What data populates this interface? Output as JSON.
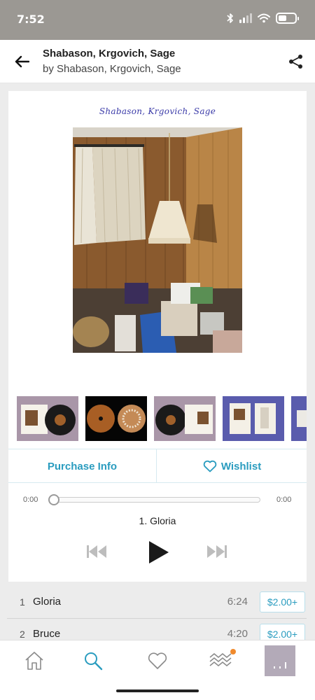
{
  "status_bar": {
    "time": "7:52"
  },
  "header": {
    "title": "Shabason, Krgovich, Sage",
    "subtitle": "by Shabason, Krgovich, Sage"
  },
  "album": {
    "handwritten_title": "Shabason, Krgovich, Sage"
  },
  "actions": {
    "purchase_label": "Purchase Info",
    "wishlist_label": "Wishlist"
  },
  "player": {
    "elapsed": "0:00",
    "duration": "0:00",
    "progress": 0,
    "now_playing": "1. Gloria"
  },
  "tracks": [
    {
      "number": "1",
      "title": "Gloria",
      "duration": "6:24",
      "price": "$2.00+"
    },
    {
      "number": "2",
      "title": "Bruce",
      "duration": "4:20",
      "price": "$2.00+"
    }
  ],
  "nav": {
    "items": [
      "home-icon",
      "search-icon",
      "heart-icon",
      "feed-icon",
      "now-playing-thumbnail"
    ],
    "active": "search-icon"
  },
  "colors": {
    "accent": "#2a9cbf",
    "status_bar": "#9b9893",
    "notification": "#f08a2c"
  }
}
